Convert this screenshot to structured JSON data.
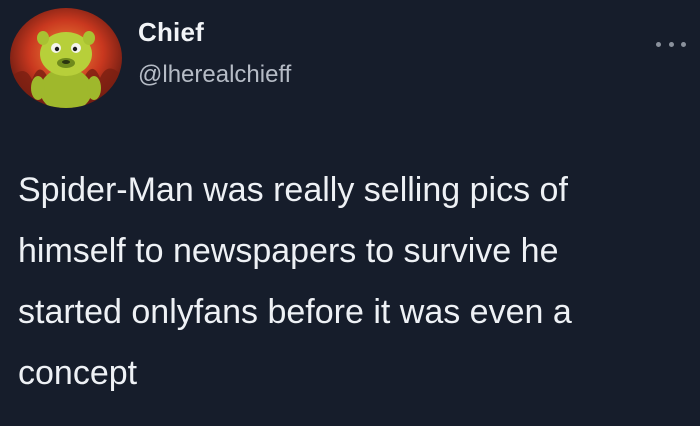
{
  "author": {
    "display_name": "Chief",
    "handle": "@lherealchieff",
    "avatar_icon": "cartoon-monster-avatar"
  },
  "menu": {
    "icon": "more-options-icon"
  },
  "tweet": {
    "text": "Spider-Man was really selling pics of\nhimself to newspapers to survive he\nstarted onlyfans before it was even a\nconcept"
  },
  "colors": {
    "background": "#161d2b",
    "text_primary": "#eef1f5",
    "text_secondary": "#b6bcc6",
    "avatar_fire": "#d3402a",
    "avatar_creature": "#b7cf3a"
  }
}
